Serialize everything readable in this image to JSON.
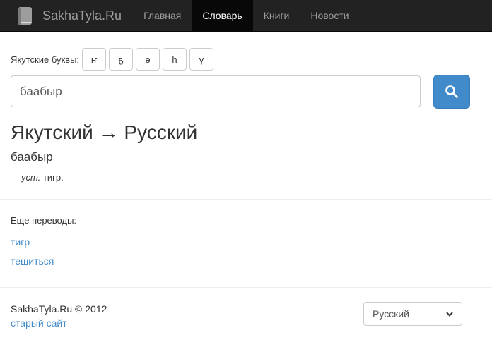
{
  "navbar": {
    "brand": "SakhaTyla.Ru",
    "items": [
      {
        "label": "Главная",
        "active": false
      },
      {
        "label": "Словарь",
        "active": true
      },
      {
        "label": "Книги",
        "active": false
      },
      {
        "label": "Новости",
        "active": false
      }
    ]
  },
  "letters": {
    "label": "Якутские буквы:",
    "buttons": [
      "ҥ",
      "ҕ",
      "ө",
      "һ",
      "ү"
    ]
  },
  "search": {
    "value": "баабыр",
    "button_icon": "search-icon"
  },
  "result": {
    "direction": "Якутский → Русский",
    "word": "баабыр",
    "note": "уст.",
    "translation": "тигр."
  },
  "more": {
    "label": "Еще переводы:",
    "links": [
      "тигр",
      "тешиться"
    ]
  },
  "footer": {
    "copyright": "SakhaTyla.Ru © 2012",
    "old_site": "старый сайт",
    "language": "Русский"
  },
  "colors": {
    "navbar_bg": "#222222",
    "accent": "#428bca",
    "link": "#428bca"
  }
}
